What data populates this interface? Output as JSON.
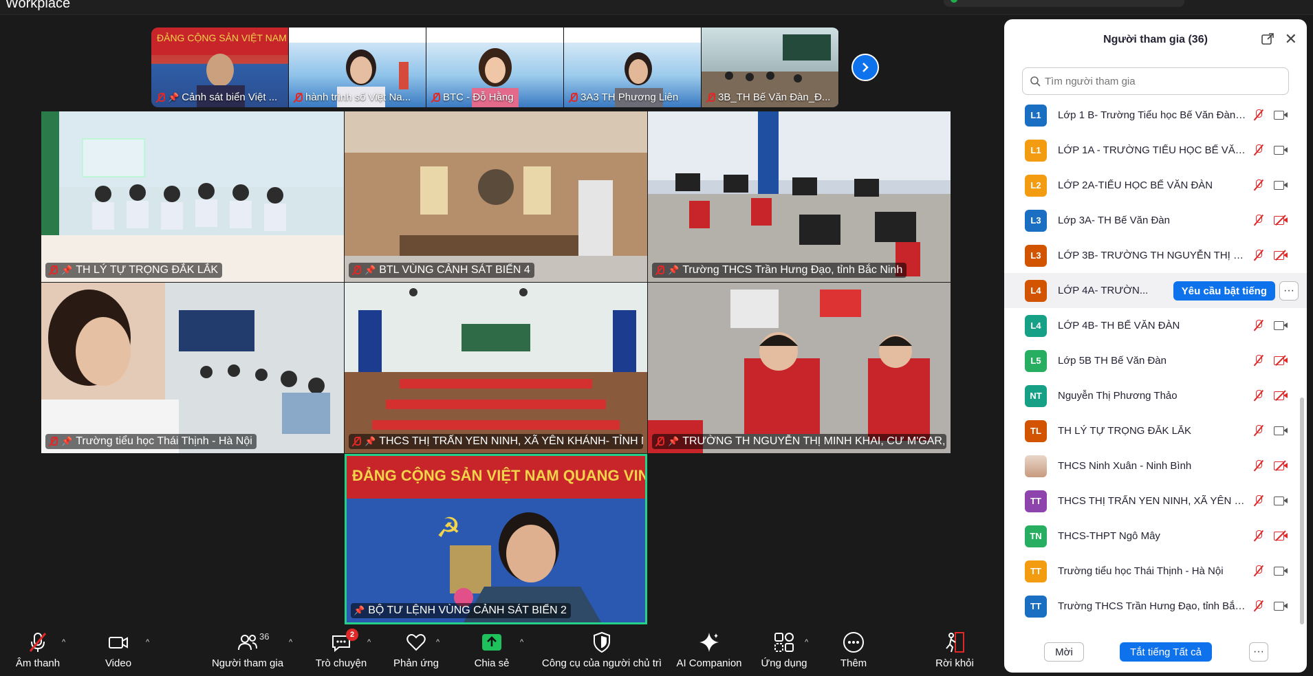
{
  "app": {
    "title": "Workplace"
  },
  "filmstrip": [
    {
      "label": "Cảnh sát biển Việt ..."
    },
    {
      "label": "hành trình số Việt Na..."
    },
    {
      "label": "BTC - Đỗ Hằng"
    },
    {
      "label": "3A3 TH Phương Liên"
    },
    {
      "label": "3B_TH Bế Văn Đàn_Đ..."
    }
  ],
  "video_grid": [
    {
      "label": "TH LÝ TỰ TRỌNG ĐẮK LẮK"
    },
    {
      "label": "BTL VÙNG CẢNH SÁT BIỂN 4"
    },
    {
      "label": "Trường THCS Trần Hưng Đạo, tỉnh Bắc Ninh"
    },
    {
      "label": "Trường tiểu học Thái Thịnh - Hà Nội"
    },
    {
      "label": "THCS THỊ TRẤN YEN NINH, XÃ YÊN KHÁNH- TỈNH NI..."
    },
    {
      "label": "TRƯỜNG TH NGUYỄN THỊ MINH KHAI, CƯ M'GAR, ĐẮ..."
    },
    {
      "label": "BỘ TƯ LỆNH VÙNG CẢNH SÁT BIỂN 2"
    }
  ],
  "toolbar": {
    "audio": "Âm thanh",
    "video": "Video",
    "participants": "Người tham gia",
    "participants_count": "36",
    "chat": "Trò chuyện",
    "chat_badge": "2",
    "reactions": "Phản ứng",
    "share": "Chia sẻ",
    "host_tools": "Công cụ của người chủ trì",
    "ai_companion": "AI Companion",
    "apps": "Ứng dụng",
    "more": "Thêm",
    "leave": "Rời khỏi"
  },
  "panel": {
    "title": "Người tham gia (36)",
    "search_placeholder": "Tìm người tham gia",
    "unmute_request": "Yêu cầu bật tiếng",
    "invite": "Mời",
    "mute_all": "Tắt tiếng Tất cả",
    "participants": [
      {
        "initials": "L1",
        "name": "Lớp 1 B- Trường Tiểu học Bế Văn Đàn-...",
        "color": "#1a6fc2",
        "cam_off": false
      },
      {
        "initials": "L1",
        "name": "LỚP 1A - TRƯỜNG TIỂU HỌC BẾ VĂN ...",
        "color": "#f39c12",
        "cam_off": false
      },
      {
        "initials": "L2",
        "name": "LỚP 2A-TIỂU HỌC BẾ VĂN ĐÀN",
        "color": "#f39c12",
        "cam_off": false
      },
      {
        "initials": "L3",
        "name": "Lớp 3A- TH Bế Văn Đàn",
        "color": "#1a6fc2",
        "cam_off": true
      },
      {
        "initials": "L3",
        "name": "LỚP 3B- TRƯỜNG TH NGUYỄN THỊ MI...",
        "color": "#d35400",
        "cam_off": true
      },
      {
        "initials": "L4",
        "name": "LỚP 4A- TRƯỜN...",
        "color": "#d35400",
        "cam_off": false,
        "highlight": true
      },
      {
        "initials": "L4",
        "name": "LỚP 4B- TH BẾ VĂN ĐÀN",
        "color": "#16a085",
        "cam_off": false
      },
      {
        "initials": "L5",
        "name": "Lớp 5B TH Bế Văn Đàn",
        "color": "#27ae60",
        "cam_off": true
      },
      {
        "initials": "NT",
        "name": "Nguyễn Thị Phương Thảo",
        "color": "#16a085",
        "cam_off": true
      },
      {
        "initials": "TL",
        "name": "TH LÝ TỰ TRỌNG ĐẮK LẮK",
        "color": "#d35400",
        "cam_off": false
      },
      {
        "initials": "",
        "name": "THCS Ninh Xuân - Ninh Bình",
        "color": "",
        "photo": true,
        "cam_off": true
      },
      {
        "initials": "TT",
        "name": "THCS THỊ TRẤN YEN NINH, XÃ YÊN K...",
        "color": "#8e44ad",
        "cam_off": false
      },
      {
        "initials": "TN",
        "name": "THCS-THPT Ngô Mây",
        "color": "#27ae60",
        "cam_off": true
      },
      {
        "initials": "TT",
        "name": "Trường tiểu học Thái Thịnh - Hà Nội",
        "color": "#f39c12",
        "cam_off": false
      },
      {
        "initials": "TT",
        "name": "Trường THCS Trần Hưng Đạo, tỉnh Bắc...",
        "color": "#1a6fc2",
        "cam_off": false
      }
    ]
  },
  "colors": {
    "accent": "#0e72ed",
    "active_speaker_border": "#23d18b",
    "muted_red": "#e02828"
  }
}
